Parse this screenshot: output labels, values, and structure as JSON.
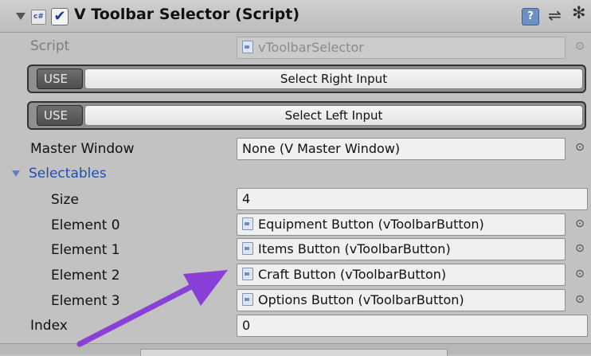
{
  "component": {
    "header_title": "V Toolbar Selector (Script)",
    "header_icon_glyph": "c#",
    "enabled_check": "✔",
    "help_glyph": "?",
    "preset_glyph": "⇌",
    "gear_glyph": "✻"
  },
  "fields": {
    "script_label": "Script",
    "script_value": "vToolbarSelector",
    "master_window_label": "Master Window",
    "master_window_value": "None (V Master Window)",
    "selectables_label": "Selectables",
    "size_label": "Size",
    "size_value": "4",
    "index_label": "Index",
    "index_value": "0"
  },
  "inputs": {
    "right": {
      "tag": "USE",
      "label": "Select Right Input"
    },
    "left": {
      "tag": "USE",
      "label": "Select Left Input"
    }
  },
  "elements": [
    {
      "label": "Element 0",
      "value": "Equipment Button (vToolbarButton)"
    },
    {
      "label": "Element 1",
      "value": "Items Button (vToolbarButton)"
    },
    {
      "label": "Element 2",
      "value": "Craft Button (vToolbarButton)"
    },
    {
      "label": "Element 3",
      "value": "Options Button (vToolbarButton)"
    }
  ],
  "picker_glyph": "⊙",
  "annotation": {
    "arrow_color": "#8a3fd6"
  }
}
